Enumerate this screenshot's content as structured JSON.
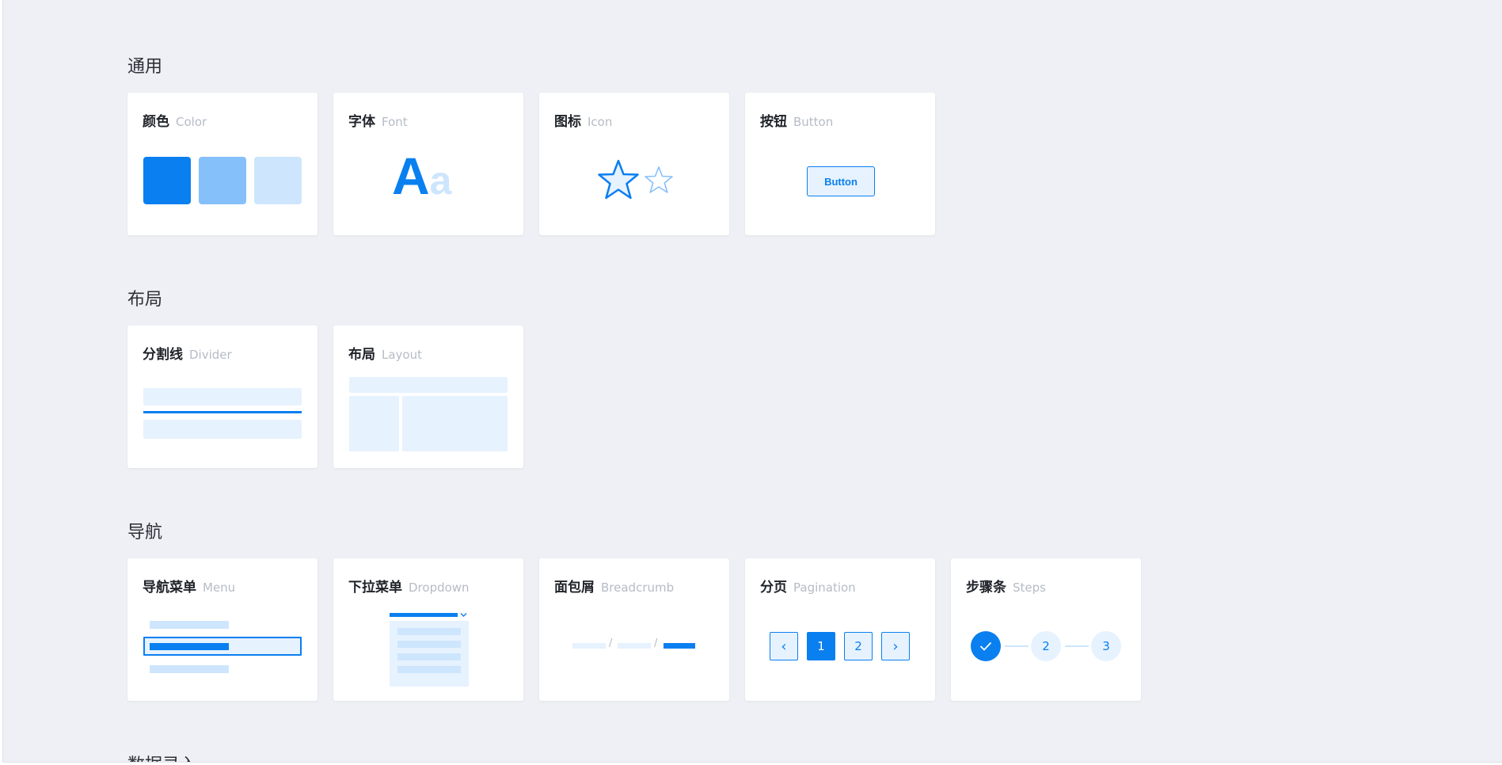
{
  "sections": {
    "general": "通用",
    "layout": "布局",
    "navigation": "导航",
    "data_entry": "数据录入"
  },
  "cards": {
    "color": {
      "title": "颜色",
      "sub": "Color"
    },
    "font": {
      "title": "字体",
      "sub": "Font",
      "glyph_big": "A",
      "glyph_small": "a"
    },
    "icon": {
      "title": "图标",
      "sub": "Icon",
      "icons": [
        "star-outline-icon",
        "star-outline-small-icon"
      ]
    },
    "button": {
      "title": "按钮",
      "sub": "Button",
      "demo_label": "Button"
    },
    "divider": {
      "title": "分割线",
      "sub": "Divider"
    },
    "layout": {
      "title": "布局",
      "sub": "Layout"
    },
    "menu": {
      "title": "导航菜单",
      "sub": "Menu"
    },
    "dropdown": {
      "title": "下拉菜单",
      "sub": "Dropdown"
    },
    "breadcrumb": {
      "title": "面包屑",
      "sub": "Breadcrumb",
      "separator": "/"
    },
    "pagination": {
      "title": "分页",
      "sub": "Pagination",
      "prev": "‹",
      "next": "›",
      "pages": [
        "1",
        "2"
      ]
    },
    "steps": {
      "title": "步骤条",
      "sub": "Steps",
      "steps": [
        "2",
        "3"
      ]
    }
  },
  "colors": {
    "primary": "#0a7ff0",
    "primary_mid": "#86c0fb",
    "primary_pale": "#cde6fd",
    "primary_paler": "#e6f2fe",
    "background": "#eef0f5"
  }
}
